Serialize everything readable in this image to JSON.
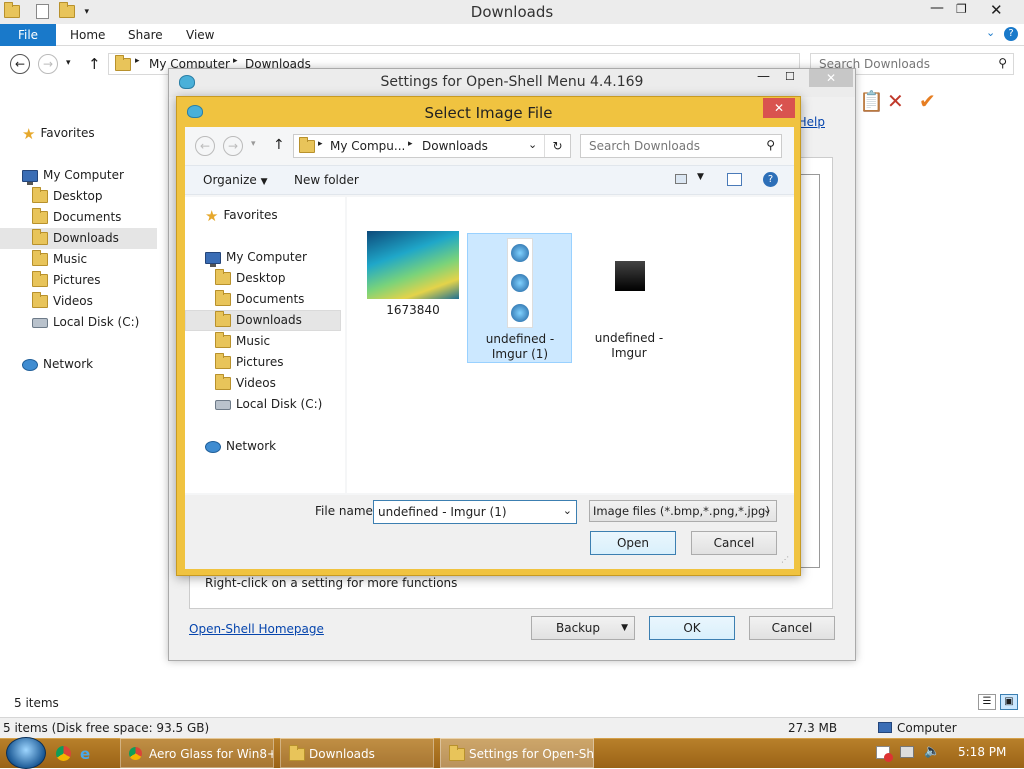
{
  "explorer": {
    "title": "Downloads",
    "ribbon_tabs": [
      "File",
      "Home",
      "Share",
      "View"
    ],
    "address": {
      "part1": "My Computer",
      "part2": "Downloads"
    },
    "search_placeholder": "Search Downloads",
    "nav": {
      "favorites": "Favorites",
      "my_computer": "My Computer",
      "desktop": "Desktop",
      "documents": "Documents",
      "downloads": "Downloads",
      "music": "Music",
      "pictures": "Pictures",
      "videos": "Videos",
      "local_disk": "Local Disk (C:)",
      "network": "Network"
    },
    "item_count": "5 items",
    "status_left": "5 items (Disk free space: 93.5 GB)",
    "status_size": "27.3 MB",
    "status_location": "Computer"
  },
  "settings": {
    "title": "Settings for Open-Shell Menu 4.4.169",
    "help_link": "Help...",
    "hint": "Right-click on a setting for more functions",
    "homepage_link": "Open-Shell Homepage",
    "backup_label": "Backup",
    "ok_label": "OK",
    "cancel_label": "Cancel"
  },
  "dialog": {
    "title": "Select Image File",
    "address": {
      "part1": "My Compu...",
      "part2": "Downloads"
    },
    "search_placeholder": "Search Downloads",
    "organize_label": "Organize",
    "new_folder_label": "New folder",
    "nav": {
      "favorites": "Favorites",
      "my_computer": "My Computer",
      "desktop": "Desktop",
      "documents": "Documents",
      "downloads": "Downloads",
      "music": "Music",
      "pictures": "Pictures",
      "videos": "Videos",
      "local_disk": "Local Disk (C:)",
      "network": "Network"
    },
    "files": [
      {
        "name": "1673840"
      },
      {
        "name": "undefined - Imgur (1)"
      },
      {
        "name": "undefined - Imgur"
      }
    ],
    "filename_label": "File name:",
    "filename_value": "undefined - Imgur (1)",
    "filetype_value": "Image files (*.bmp,*.png,*.jpg)",
    "open_label": "Open",
    "cancel_label": "Cancel"
  },
  "taskbar": {
    "items": [
      {
        "label": "Aero Glass for Win8+..."
      },
      {
        "label": "Downloads"
      },
      {
        "label": "Settings for Open-Sh..."
      }
    ],
    "time": "5:18 PM"
  },
  "colors": {
    "accent": "#1979ca",
    "dialog_frame": "#f0c340",
    "selection": "#cce8ff",
    "taskbar": "#a36a1a"
  }
}
